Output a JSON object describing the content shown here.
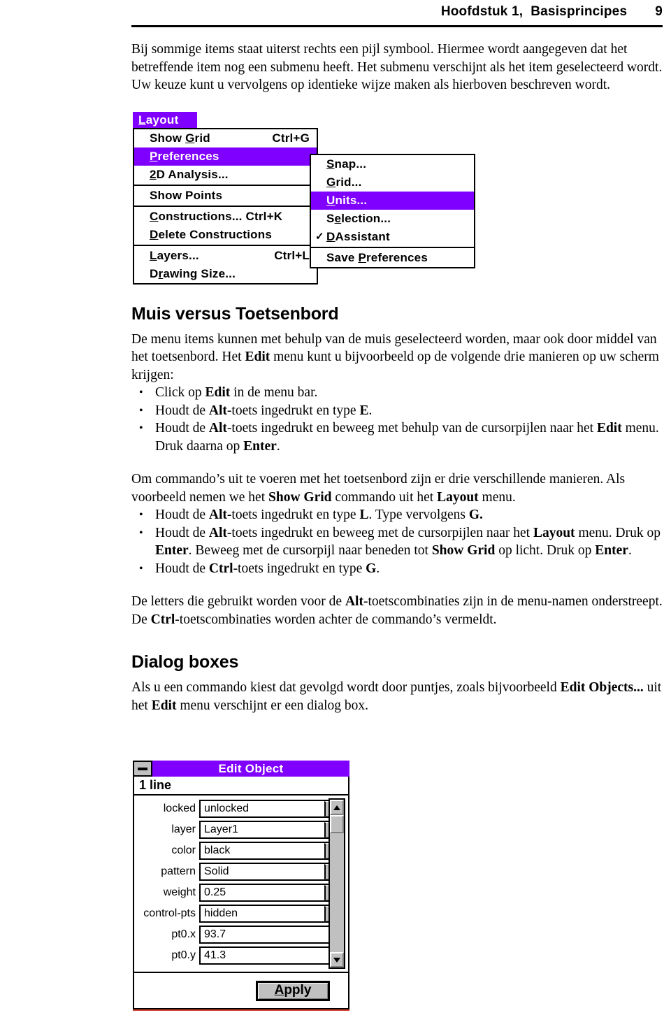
{
  "header": {
    "chapter_title": "Hoofdstuk 1,  Basisprincipes",
    "page_number": "9"
  },
  "intro_paragraph": "Bij sommige items staat uiterst rechts een pijl symbool. Hiermee wordt aangegeven dat het betreffende item nog een submenu heeft. Het submenu verschijnt als het item geselecteerd wordt. Uw keuze kunt u vervolgens op identieke wijze maken als hierboven beschreven wordt.",
  "menu_figure": {
    "menu_bar_title": "Layout",
    "items": [
      {
        "label": "Show Grid",
        "accel": "Ctrl+G",
        "selected": false,
        "checked": false,
        "separator_after": false
      },
      {
        "label": "Preferences",
        "accel": "",
        "selected": true,
        "checked": false,
        "separator_after": false
      },
      {
        "label": "2D Analysis...",
        "accel": "",
        "selected": false,
        "checked": false,
        "separator_after": true
      },
      {
        "label": "Show Points",
        "accel": "",
        "selected": false,
        "checked": false,
        "separator_after": true
      },
      {
        "label": "Constructions... Ctrl+K",
        "accel": "",
        "selected": false,
        "checked": false,
        "separator_after": false
      },
      {
        "label": "Delete Constructions",
        "accel": "",
        "selected": false,
        "checked": false,
        "separator_after": true
      },
      {
        "label": "Layers...",
        "accel": "Ctrl+L",
        "selected": false,
        "checked": false,
        "separator_after": false
      },
      {
        "label": "Drawing Size...",
        "accel": "",
        "selected": false,
        "checked": false,
        "separator_after": false
      }
    ],
    "submenu_items": [
      {
        "label": "Snap...",
        "selected": false,
        "checked": false,
        "separator_after": false
      },
      {
        "label": "Grid...",
        "selected": false,
        "checked": false,
        "separator_after": false
      },
      {
        "label": "Units...",
        "selected": true,
        "checked": false,
        "separator_after": false
      },
      {
        "label": "Selection...",
        "selected": false,
        "checked": false,
        "separator_after": false
      },
      {
        "label": "DAssistant",
        "selected": false,
        "checked": true,
        "separator_after": true
      },
      {
        "label": "Save Preferences",
        "selected": false,
        "checked": false,
        "separator_after": false
      }
    ],
    "highlight_color": "#8000FF"
  },
  "section_mouse": {
    "heading": "Muis versus Toetsenbord",
    "paragraph": "De menu items kunnen met behulp van de muis geselecteerd worden, maar ook door middel van het toetsenbord. Het Edit menu kunt u bijvoorbeeld op de volgende drie manieren op uw scherm krijgen:",
    "bullets": [
      "Click op Edit in de menu bar.",
      "Houdt de Alt-toets ingedrukt en type E.",
      "Houdt de Alt-toets ingedrukt en beweeg met behulp van de cursorpijlen naar het Edit menu. Druk daarna op Enter."
    ]
  },
  "section_commands": {
    "paragraph": "Om commando’s uit te voeren met het toetsenbord zijn er drie verschillende manieren. Als voorbeeld nemen we het Show Grid commando uit het Layout menu.",
    "bullets": [
      "Houdt de Alt-toets ingedrukt en type L. Type vervolgens G.",
      "Houdt de Alt-toets ingedrukt en beweeg met de cursorpijlen naar het Layout menu. Druk op Enter. Beweeg met de cursorpijl naar beneden tot Show Grid op licht. Druk op Enter.",
      "Houdt de Ctrl-toets ingedrukt en type G."
    ],
    "closing_paragraph": "De letters die gebruikt worden voor de Alt-toetscombinaties zijn in de menu-namen onderstreept. De Ctrl-toetscombinaties worden achter de commando’s vermeldt."
  },
  "section_dialog": {
    "heading": "Dialog boxes",
    "paragraph": "Als u een commando kiest dat gevolgd wordt door puntjes, zoals bijvoorbeeld Edit Objects... uit het Edit menu verschijnt er een dialog box."
  },
  "dialog_figure": {
    "title": "Edit Object",
    "subtitle": "1 line",
    "minimize_icon": "minimize-icon",
    "fields": [
      {
        "label": "locked",
        "value": "unlocked",
        "has_dropdown": true
      },
      {
        "label": "layer",
        "value": "Layer1",
        "has_dropdown": true
      },
      {
        "label": "color",
        "value": "black",
        "has_dropdown": true
      },
      {
        "label": "pattern",
        "value": "Solid",
        "has_dropdown": true
      },
      {
        "label": "weight",
        "value": "0.25",
        "has_dropdown": true
      },
      {
        "label": "control-pts",
        "value": "hidden",
        "has_dropdown": true
      },
      {
        "label": "pt0.x",
        "value": "93.7",
        "has_dropdown": false
      },
      {
        "label": "pt0.y",
        "value": "41.3",
        "has_dropdown": false
      }
    ],
    "apply_label": "Apply",
    "titlebar_color": "#8000FF"
  }
}
